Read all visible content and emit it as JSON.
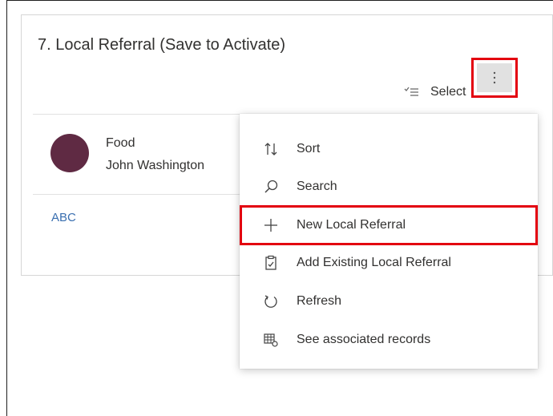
{
  "card": {
    "title": "7. Local Referral (Save to Activate)",
    "select_label": "Select",
    "select_icon": "checklist-icon",
    "more_icon": "vertical-ellipsis-icon"
  },
  "record": {
    "name": "Food",
    "owner": "John Washington",
    "avatar_color": "#5f2a43"
  },
  "link": {
    "label": "ABC"
  },
  "menu": {
    "items": [
      {
        "label": "Sort",
        "icon": "sort-icon"
      },
      {
        "label": "Search",
        "icon": "search-icon"
      },
      {
        "label": "New Local Referral",
        "icon": "plus-icon",
        "highlighted": true
      },
      {
        "label": "Add Existing Local Referral",
        "icon": "clipboard-add-icon"
      },
      {
        "label": "Refresh",
        "icon": "refresh-icon"
      },
      {
        "label": "See associated records",
        "icon": "table-associated-icon"
      }
    ]
  },
  "colors": {
    "highlight": "#e3000f",
    "link": "#3a6fb0",
    "button_bg": "#e1e1e1"
  }
}
